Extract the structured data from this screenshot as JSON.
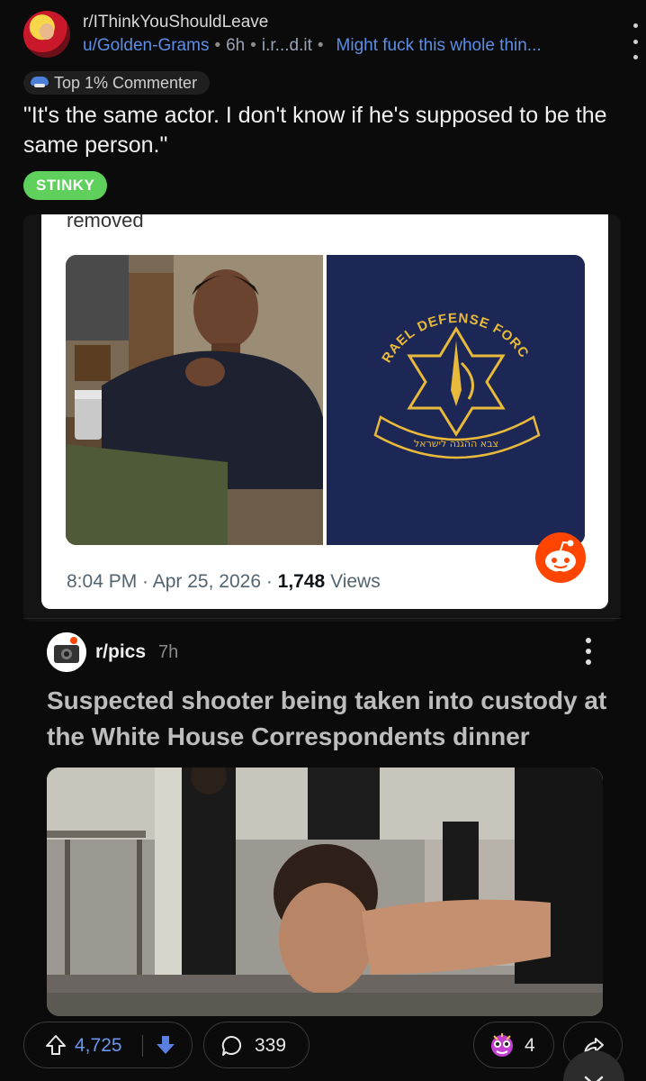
{
  "header": {
    "subreddit": "r/IThinkYouShouldLeave",
    "user": "u/Golden-Grams",
    "age": "6h",
    "domain": "i.r...d.it",
    "user_flair": "Might fuck this whole thin...",
    "top_badge": "Top 1% Commenter"
  },
  "comment": {
    "text": "\"It's the same actor. I don't know if he's supposed to be the same person.\"",
    "flair": "STINKY"
  },
  "embed": {
    "removed_text": "removed",
    "time": "8:04 PM",
    "date": "Apr 25, 2026",
    "views_count": "1,748",
    "views_label": "Views",
    "shirt_text_top": "ISRAEL DEFENSE FORCES",
    "shirt_text_bottom": "צבא ההגנה לישראל"
  },
  "inner_post": {
    "subreddit": "r/pics",
    "age": "7h",
    "title": "Suspected shooter being taken into custody at the White House Correspondents dinner"
  },
  "actions": {
    "upvotes": "4,725",
    "comments": "339",
    "awards": "4"
  },
  "icons": [
    "reddit-avatar-icon",
    "medal-icon",
    "reddit-snoo-icon",
    "kebab-icon",
    "upvote-icon",
    "downvote-icon",
    "comment-icon",
    "award-icon",
    "share-icon",
    "close-icon"
  ],
  "colors": {
    "background": "#0b0b0b",
    "link_blue": "#5d8ee6",
    "flair_green": "#5fd05b",
    "downvote_blue": "#5b7fe0",
    "reddit_orange": "#ff4500"
  }
}
